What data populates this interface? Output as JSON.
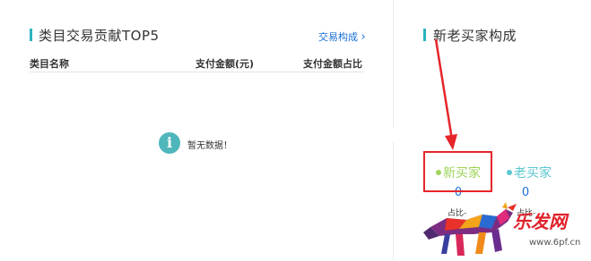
{
  "left_panel": {
    "title": "类目交易贡献TOP5",
    "link": "交易构成",
    "link_chevron": "›",
    "columns": [
      "类目名称",
      "支付金额(元)",
      "支付金额占比"
    ],
    "empty_icon": "info-icon",
    "empty_glyph": "i",
    "empty_text": "暂无数据！"
  },
  "right_panel": {
    "title": "新老买家构成",
    "legend": [
      {
        "label": "新买家",
        "color": "#9fd35a",
        "value": "0",
        "ratio_label": "占比-"
      },
      {
        "label": "老买家",
        "color": "#5bc7d0",
        "value": "0",
        "ratio_label": "占比-"
      }
    ]
  },
  "annotation": {
    "color": "#e5262a"
  },
  "watermark": {
    "text": "乐发网",
    "url": "www.6pf.cn"
  },
  "colors": {
    "accent": "#2bb3c0",
    "link": "#1a6fd6"
  }
}
